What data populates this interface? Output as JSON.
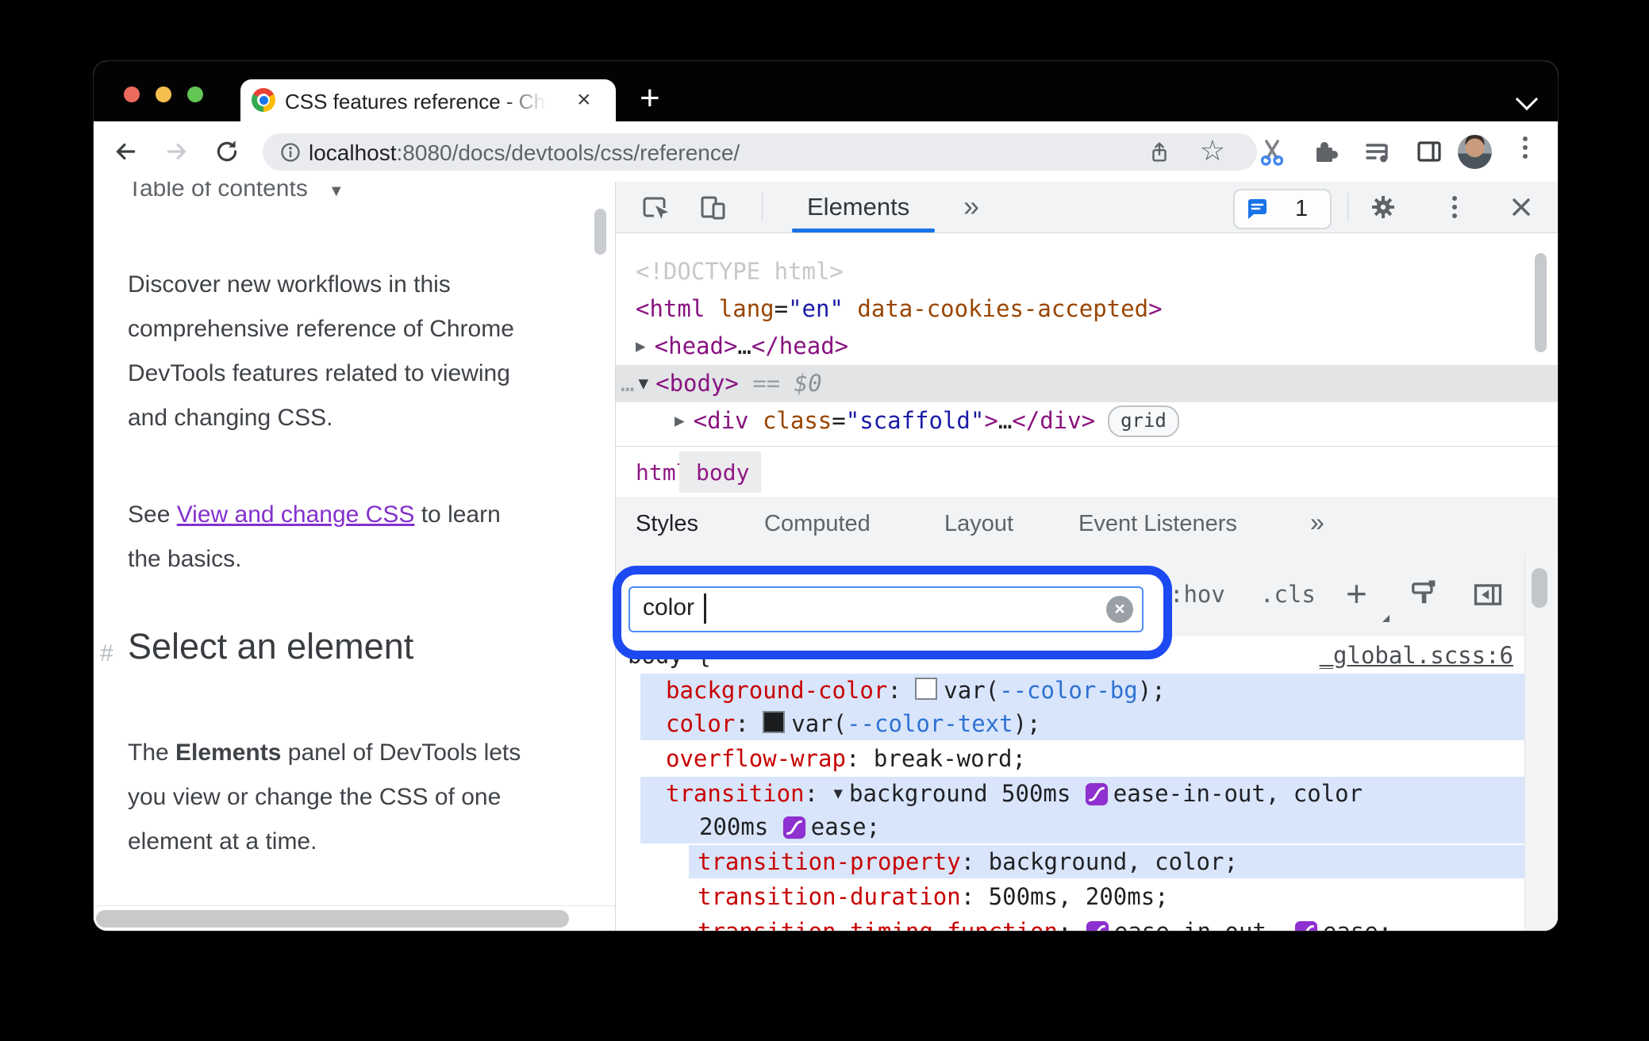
{
  "colors": {
    "accent_blue": "#1a73e8",
    "annotation_ring_blue": "#1c49f2",
    "match_highlight_blue": "#d9e5fb",
    "tag_purple": "#881280",
    "attr_orange": "#994500",
    "attr_value_blue": "#1a1aa6",
    "property_red": "#c80000",
    "doc_link_purple": "#8430ce"
  },
  "browser": {
    "tab_title": "CSS features reference - Chrom",
    "new_tab_label": "+",
    "close_tab_label": "×",
    "url_host": "localhost",
    "url_path": ":8080/docs/devtools/css/reference/"
  },
  "page": {
    "toc_label": "Table of contents",
    "toc_arrow": "▼",
    "p1": "Discover new workflows in this\ncomprehensive reference of Chrome\nDevTools features related to viewing\nand changing CSS.",
    "p2_pre": "See ",
    "p2_link": "View and change CSS",
    "p2_post": " to learn\nthe basics.",
    "heading_hash": "#",
    "heading": "Select an element",
    "p3_pre": "The ",
    "p3_bold": "Elements",
    "p3_post": " panel of DevTools lets\nyou view or change the CSS of one\nelement at a time."
  },
  "devtools": {
    "panel_tab": "Elements",
    "more_panels": "»",
    "issues_count": "1",
    "close_label": "×",
    "dom": {
      "l1": [
        {
          "t": "<!DOCTYPE html>",
          "k": "doctype"
        }
      ],
      "l2": [
        {
          "t": "<html",
          "k": "tag"
        },
        {
          "t": " ",
          "k": "plain"
        },
        {
          "t": "lang",
          "k": "attr"
        },
        {
          "t": "=",
          "k": "plain"
        },
        {
          "t": "\"en\"",
          "k": "val"
        },
        {
          "t": " ",
          "k": "plain"
        },
        {
          "t": "data-cookies-accepted",
          "k": "attr"
        },
        {
          "t": ">",
          "k": "tag"
        }
      ],
      "l3": [
        {
          "t": "▶",
          "k": "arrow"
        },
        {
          "t": "<head>",
          "k": "tag"
        },
        {
          "t": "…",
          "k": "meta"
        },
        {
          "t": "</head>",
          "k": "tag"
        }
      ],
      "l4": [
        {
          "t": "…",
          "k": "dots"
        },
        {
          "t": "▼",
          "k": "darrow"
        },
        {
          "t": "<body>",
          "k": "tag"
        },
        {
          "t": " == ",
          "k": "eq"
        },
        {
          "t": "$0",
          "k": "dollar"
        }
      ],
      "l5": [
        {
          "t": "▶",
          "k": "arrow"
        },
        {
          "t": "<div",
          "k": "tag"
        },
        {
          "t": " ",
          "k": "plain"
        },
        {
          "t": "class",
          "k": "attr"
        },
        {
          "t": "=",
          "k": "plain"
        },
        {
          "t": "\"scaffold\"",
          "k": "val"
        },
        {
          "t": ">",
          "k": "tag"
        },
        {
          "t": "…",
          "k": "meta"
        },
        {
          "t": "</div>",
          "k": "tag"
        }
      ],
      "grid_badge": "grid"
    },
    "breadcrumb": {
      "html": "html",
      "body": "body"
    },
    "sidebar_tabs": [
      "Styles",
      "Computed",
      "Layout",
      "Event Listeners"
    ],
    "sidebar_more": "»",
    "filter": {
      "value": "color",
      "clear_label": "×"
    },
    "toolbar2": {
      "hov": ":hov",
      "cls": ".cls",
      "plus": "+"
    },
    "rule": {
      "selector": "body {",
      "source": "_global.scss:6",
      "bg": [
        {
          "t": "background-color",
          "k": "prop"
        },
        {
          "t": ": ",
          "k": "plain"
        },
        {
          "t": "",
          "k": "swatch-light"
        },
        {
          "t": "var(",
          "k": "plain"
        },
        {
          "t": "--color-bg",
          "k": "varlink"
        },
        {
          "t": ");",
          "k": "plain"
        }
      ],
      "color": [
        {
          "t": "color",
          "k": "prop"
        },
        {
          "t": ": ",
          "k": "plain"
        },
        {
          "t": "",
          "k": "swatch-dark"
        },
        {
          "t": "var(",
          "k": "plain"
        },
        {
          "t": "--color-text",
          "k": "varlink"
        },
        {
          "t": ");",
          "k": "plain"
        }
      ],
      "overflow": [
        {
          "t": "overflow-wrap",
          "k": "prop"
        },
        {
          "t": ": ",
          "k": "plain"
        },
        {
          "t": "break-word;",
          "k": "plain"
        }
      ],
      "transition1": [
        {
          "t": "transition",
          "k": "prop"
        },
        {
          "t": ": ",
          "k": "plain"
        },
        {
          "t": "▼",
          "k": "tri"
        },
        {
          "t": "background 500ms ",
          "k": "plain"
        },
        {
          "t": "",
          "k": "bez"
        },
        {
          "t": "ease-in-out, color",
          "k": "plain"
        }
      ],
      "transition2": [
        {
          "t": "200ms ",
          "k": "plain"
        },
        {
          "t": "",
          "k": "bez"
        },
        {
          "t": "ease;",
          "k": "plain"
        }
      ],
      "tprop": [
        {
          "t": "transition-property",
          "k": "prop"
        },
        {
          "t": ": ",
          "k": "plain"
        },
        {
          "t": "background, color;",
          "k": "plain"
        }
      ],
      "tdur": [
        {
          "t": "transition-duration",
          "k": "prop"
        },
        {
          "t": ": ",
          "k": "plain"
        },
        {
          "t": "500ms, 200ms;",
          "k": "plain"
        }
      ],
      "ttf": [
        {
          "t": "transition-timing-function",
          "k": "prop"
        },
        {
          "t": ": ",
          "k": "plain"
        },
        {
          "t": "",
          "k": "bez"
        },
        {
          "t": "ease-in-out, ",
          "k": "plain"
        },
        {
          "t": "",
          "k": "bez"
        },
        {
          "t": "ease;",
          "k": "plain"
        }
      ]
    }
  }
}
